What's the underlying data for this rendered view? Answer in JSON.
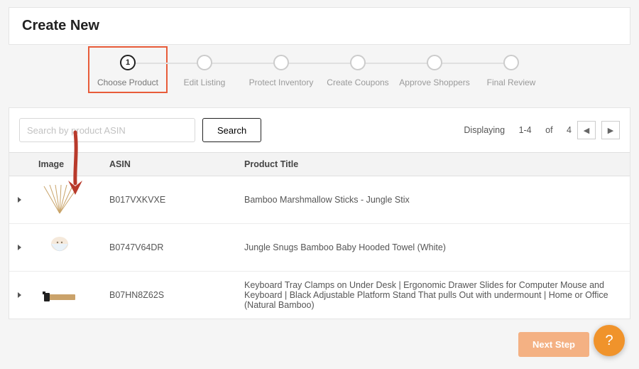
{
  "header": {
    "title": "Create New"
  },
  "stepper": {
    "active_index": 0,
    "steps": [
      {
        "num": "1",
        "label": "Choose Product"
      },
      {
        "num": "",
        "label": "Edit Listing"
      },
      {
        "num": "",
        "label": "Protect Inventory"
      },
      {
        "num": "",
        "label": "Create Coupons"
      },
      {
        "num": "",
        "label": "Approve Shoppers"
      },
      {
        "num": "",
        "label": "Final Review"
      }
    ]
  },
  "search": {
    "placeholder": "Search by product ASIN",
    "button_label": "Search"
  },
  "pager": {
    "displaying_label": "Displaying",
    "range": "1-4",
    "of_label": "of",
    "total": "4"
  },
  "table": {
    "headers": {
      "image": "Image",
      "asin": "ASIN",
      "title": "Product Title"
    },
    "rows": [
      {
        "asin": "B017VXKVXE",
        "title": "Bamboo Marshmallow Sticks - Jungle Stix"
      },
      {
        "asin": "B0747V64DR",
        "title": "Jungle Snugs Bamboo Baby Hooded Towel (White)"
      },
      {
        "asin": "B07HN8Z62S",
        "title": "Keyboard Tray Clamps on Under Desk | Ergonomic Drawer Slides for Computer Mouse and Keyboard | Black Adjustable Platform Stand That pulls Out with undermount | Home or Office (Natural Bamboo)"
      }
    ]
  },
  "footer": {
    "next_label": "Next Step",
    "help_label": "?"
  },
  "colors": {
    "accent_orange": "#f0932b",
    "highlight_red": "#e85c3a"
  }
}
